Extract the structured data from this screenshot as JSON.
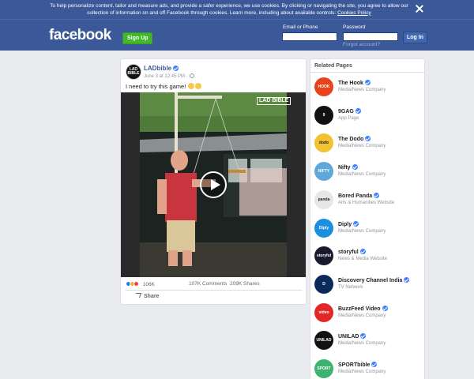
{
  "cookie_banner": {
    "text": "To help personalize content, tailor and measure ads, and provide a safer experience, we use cookies. By clicking or navigating the site, you agree to allow our collection of information on and off Facebook through cookies. Learn more, including about available controls: ",
    "link": "Cookies Policy",
    "close_icon": "close-icon"
  },
  "header": {
    "logo": "facebook",
    "signup_label": "Sign Up",
    "email_label": "Email or Phone",
    "password_label": "Password",
    "login_label": "Log In",
    "forgot_label": "Forgot account?"
  },
  "post": {
    "avatar_text": "LAD BIBLE",
    "page_name": "LADbible",
    "time": "June 3 at 12:45 PM ·",
    "text": "I need to try this game!",
    "watermark": "LAD BIBLE",
    "reactions": "106K",
    "comments": "107K Comments",
    "shares": "209K Shares",
    "share_label": "Share",
    "colors": {
      "link": "#385898",
      "verified": "#4080ff"
    }
  },
  "related": {
    "title": "Related Pages",
    "items": [
      {
        "name": "The Hook",
        "category": "Media/News Company",
        "logo": "HOOK",
        "color": "#e8421a"
      },
      {
        "name": "9GAG",
        "category": "App Page",
        "logo": "9",
        "color": "#111111"
      },
      {
        "name": "The Dodo",
        "category": "Media/News Company",
        "logo": "dodo",
        "color": "#f2c232"
      },
      {
        "name": "Nifty",
        "category": "Media/News Company",
        "logo": "NIFTY",
        "color": "#5fa8d8"
      },
      {
        "name": "Bored Panda",
        "category": "Arts & Humanities Website",
        "logo": "panda",
        "color": "#e6e6e6"
      },
      {
        "name": "Diply",
        "category": "Media/News Company",
        "logo": "Diply",
        "color": "#1a8fe0"
      },
      {
        "name": "storyful",
        "category": "News & Media Website",
        "logo": "storyful",
        "color": "#1a1a2e"
      },
      {
        "name": "Discovery Channel India",
        "category": "TV Network",
        "logo": "D",
        "color": "#0a2a5a"
      },
      {
        "name": "BuzzFeed Video",
        "category": "Media/News Company",
        "logo": "video",
        "color": "#e32626"
      },
      {
        "name": "UNILAD",
        "category": "Media/News Company",
        "logo": "UNILAD",
        "color": "#111111"
      },
      {
        "name": "SPORTbible",
        "category": "Media/News Company",
        "logo": "SPORT",
        "color": "#3cb371"
      }
    ]
  }
}
